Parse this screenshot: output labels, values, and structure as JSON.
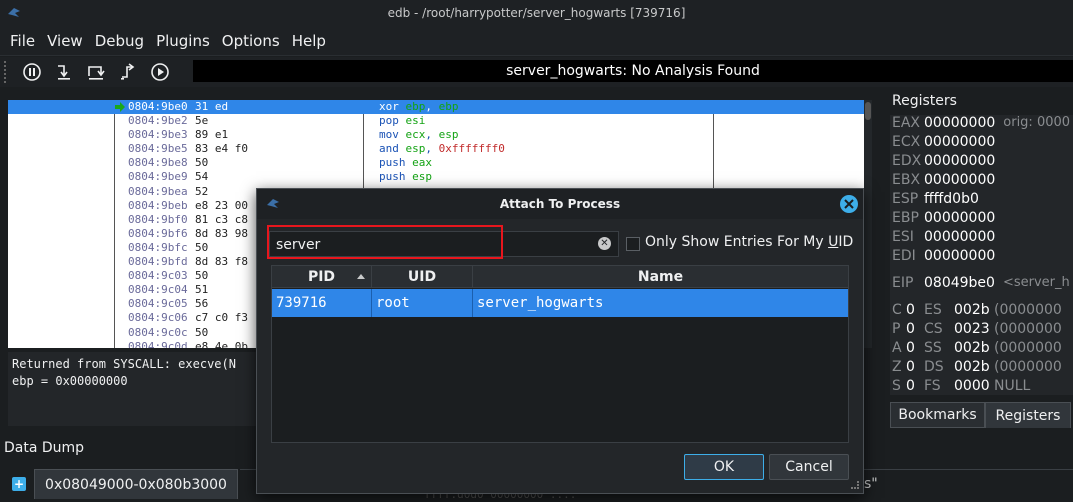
{
  "window": {
    "title": "edb - /root/harrypotter/server_hogwarts [739716]"
  },
  "menu": [
    "File",
    "View",
    "Debug",
    "Plugins",
    "Options",
    "Help"
  ],
  "toolbar": {
    "icons": [
      "pause-icon",
      "step-into-icon",
      "step-over-icon",
      "step-out-icon",
      "run-icon"
    ],
    "analysis_status": "server_hogwarts: No Analysis Found"
  },
  "disasm": [
    {
      "addr": "0804:9be0",
      "bytes": "31 ed",
      "ins": [
        "xor ",
        "ebp",
        ", ",
        "ebp",
        ""
      ],
      "selected": true
    },
    {
      "addr": "0804:9be2",
      "bytes": "5e",
      "ins": [
        "pop ",
        "esi",
        "",
        "",
        ""
      ]
    },
    {
      "addr": "0804:9be3",
      "bytes": "89 e1",
      "ins": [
        "mov ",
        "ecx",
        ", ",
        "esp",
        ""
      ]
    },
    {
      "addr": "0804:9be5",
      "bytes": "83 e4 f0",
      "ins": [
        "and ",
        "esp",
        ", ",
        "",
        "0xfffffff0"
      ]
    },
    {
      "addr": "0804:9be8",
      "bytes": "50",
      "ins": [
        "push ",
        "eax",
        "",
        "",
        ""
      ]
    },
    {
      "addr": "0804:9be9",
      "bytes": "54",
      "ins": [
        "push ",
        "esp",
        "",
        "",
        ""
      ]
    },
    {
      "addr": "0804:9bea",
      "bytes": "52",
      "ins": [
        "",
        "",
        "",
        "",
        ""
      ]
    },
    {
      "addr": "0804:9beb",
      "bytes": "e8 23 00",
      "ins": [
        "",
        "",
        "",
        "",
        ""
      ]
    },
    {
      "addr": "0804:9bf0",
      "bytes": "81 c3 c8",
      "ins": [
        "",
        "",
        "",
        "",
        ""
      ]
    },
    {
      "addr": "0804:9bf6",
      "bytes": "8d 83 98",
      "ins": [
        "",
        "",
        "",
        "",
        ""
      ]
    },
    {
      "addr": "0804:9bfc",
      "bytes": "50",
      "ins": [
        "",
        "",
        "",
        "",
        ""
      ]
    },
    {
      "addr": "0804:9bfd",
      "bytes": "8d 83 f8",
      "ins": [
        "",
        "",
        "",
        "",
        ""
      ]
    },
    {
      "addr": "0804:9c03",
      "bytes": "50",
      "ins": [
        "",
        "",
        "",
        "",
        ""
      ]
    },
    {
      "addr": "0804:9c04",
      "bytes": "51",
      "ins": [
        "",
        "",
        "",
        "",
        ""
      ]
    },
    {
      "addr": "0804:9c05",
      "bytes": "56",
      "ins": [
        "",
        "",
        "",
        "",
        ""
      ]
    },
    {
      "addr": "0804:9c06",
      "bytes": "c7 c0 f3",
      "ins": [
        "",
        "",
        "",
        "",
        ""
      ]
    },
    {
      "addr": "0804:9c0c",
      "bytes": "50",
      "ins": [
        "",
        "",
        "",
        "",
        ""
      ]
    },
    {
      "addr": "0804:9c0d",
      "bytes": "e8 4e 0b",
      "ins": [
        "",
        "",
        "",
        "",
        ""
      ]
    }
  ],
  "status": {
    "line1": "Returned from SYSCALL: execve(N",
    "line2": "ebp = 0x00000000"
  },
  "data_dump": {
    "label": "Data Dump",
    "tab": "0x08049000-0x080b3000",
    "strip": "ffff:d0d0 00000000 ....",
    "quote": "s\""
  },
  "registers": {
    "title": "Registers",
    "rows": [
      {
        "name": "EAX",
        "value": "00000000",
        "extra": "orig: 0000"
      },
      {
        "name": "ECX",
        "value": "00000000",
        "extra": ""
      },
      {
        "name": "EDX",
        "value": "00000000",
        "extra": ""
      },
      {
        "name": "EBX",
        "value": "00000000",
        "extra": ""
      },
      {
        "name": "ESP",
        "value": "ffffd0b0",
        "extra": ""
      },
      {
        "name": "EBP",
        "value": "00000000",
        "extra": ""
      },
      {
        "name": "ESI",
        "value": "00000000",
        "extra": ""
      },
      {
        "name": "EDI",
        "value": "00000000",
        "extra": ""
      },
      {
        "name": "EIP",
        "value": "08049be0",
        "extra": "<server_h"
      }
    ],
    "flags": [
      {
        "f": "C",
        "fv": "0",
        "s": "ES",
        "sv": "002b",
        "sx": "(0000000"
      },
      {
        "f": "P",
        "fv": "0",
        "s": "CS",
        "sv": "0023",
        "sx": "(0000000"
      },
      {
        "f": "A",
        "fv": "0",
        "s": "SS",
        "sv": "002b",
        "sx": "(0000000"
      },
      {
        "f": "Z",
        "fv": "0",
        "s": "DS",
        "sv": "002b",
        "sx": "(0000000"
      },
      {
        "f": "S",
        "fv": "0",
        "s": "FS",
        "sv": "0000",
        "sx": "NULL"
      }
    ],
    "tabs": [
      "Bookmarks",
      "Registers"
    ]
  },
  "dialog": {
    "title": "Attach To Process",
    "search_value": "server",
    "filter_label_prefix": "Only Show Entries For My ",
    "filter_label_u": "U",
    "filter_label_suffix": "ID",
    "filter_checked": false,
    "columns": [
      "PID",
      "UID",
      "Name"
    ],
    "rows": [
      {
        "pid": "739716",
        "uid": "root",
        "name": "server_hogwarts"
      }
    ],
    "ok_label": "OK",
    "cancel_label": "Cancel"
  },
  "colors": {
    "selection": "#2f86e8",
    "accent": "#3daee9",
    "highlight_box": "#e8161d"
  }
}
